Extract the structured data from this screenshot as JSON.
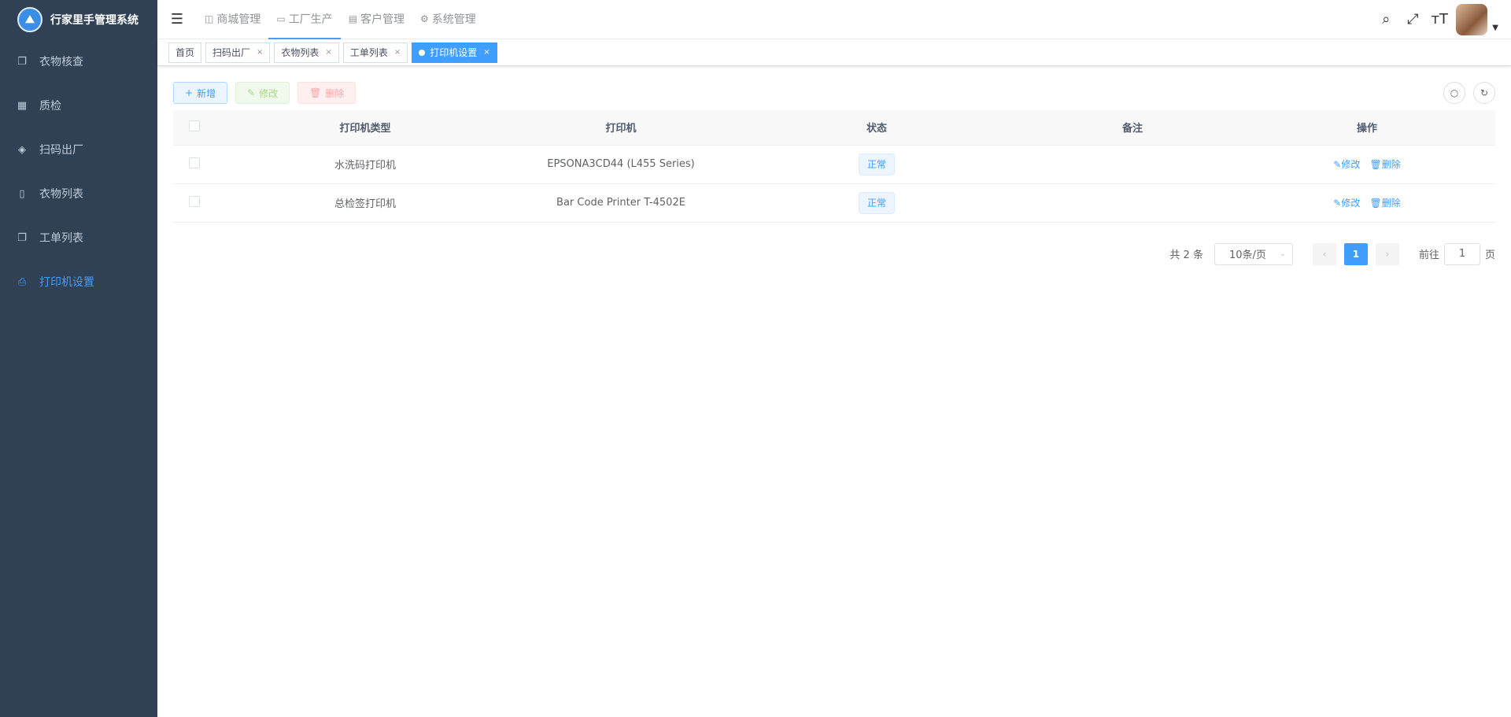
{
  "app": {
    "title": "行家里手管理系统",
    "logo_icon": "logo-icon"
  },
  "sidebar": {
    "items": [
      {
        "label": "衣物核查",
        "icon": "copy-icon",
        "active": false
      },
      {
        "label": "质检",
        "icon": "table-icon",
        "active": false
      },
      {
        "label": "扫码出厂",
        "icon": "layers-icon",
        "active": false
      },
      {
        "label": "衣物列表",
        "icon": "phone-icon",
        "active": false
      },
      {
        "label": "工单列表",
        "icon": "copy-icon",
        "active": false
      },
      {
        "label": "打印机设置",
        "icon": "printer-icon",
        "active": true
      }
    ]
  },
  "topnav": {
    "items": [
      {
        "label": "商城管理",
        "icon": "database-icon"
      },
      {
        "label": "工厂生产",
        "icon": "monitor-icon",
        "active": true
      },
      {
        "label": "客户管理",
        "icon": "grid-icon"
      },
      {
        "label": "系统管理",
        "icon": "gear-icon"
      }
    ]
  },
  "tags": [
    {
      "label": "首页",
      "closable": false
    },
    {
      "label": "扫码出厂",
      "closable": true
    },
    {
      "label": "衣物列表",
      "closable": true
    },
    {
      "label": "工单列表",
      "closable": true
    },
    {
      "label": "打印机设置",
      "closable": true,
      "active": true
    }
  ],
  "toolbar": {
    "add": "新增",
    "edit": "修改",
    "delete": "删除"
  },
  "table": {
    "headers": [
      "打印机类型",
      "打印机",
      "状态",
      "备注",
      "操作"
    ],
    "rows": [
      {
        "type": "水洗码打印机",
        "printer": "EPSONA3CD44 (L455 Series)",
        "status": "正常",
        "remark": "",
        "edit": "修改",
        "delete": "删除"
      },
      {
        "type": "总检签打印机",
        "printer": "Bar Code Printer T-4502E",
        "status": "正常",
        "remark": "",
        "edit": "修改",
        "delete": "删除"
      }
    ]
  },
  "pagination": {
    "total": "共 2 条",
    "page_size": "10条/页",
    "current": "1",
    "goto_label": "前往",
    "goto_value": "1",
    "page_suffix": "页"
  },
  "colors": {
    "sidebar_bg": "#304156",
    "primary": "#409eff"
  }
}
